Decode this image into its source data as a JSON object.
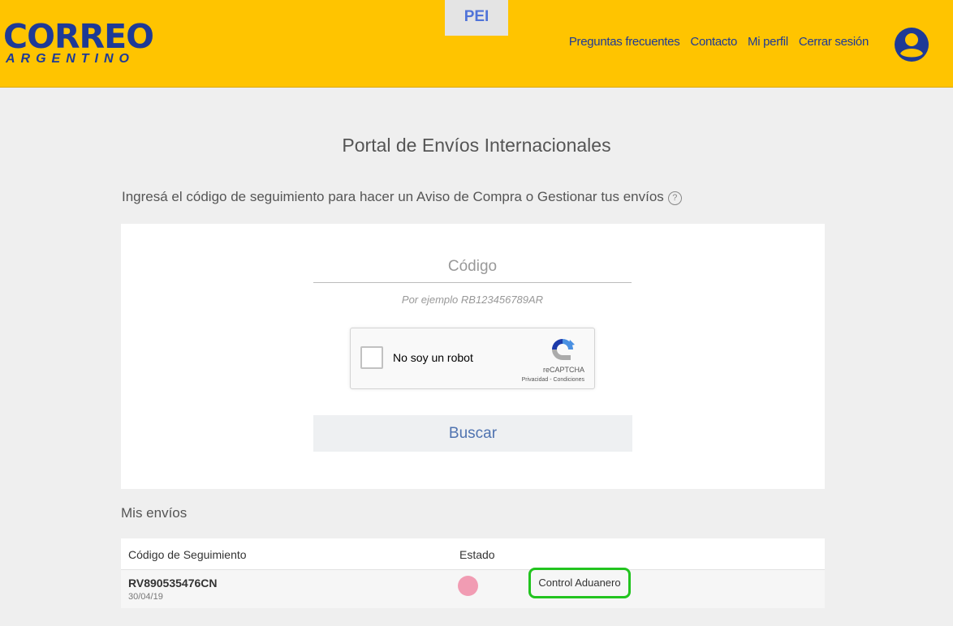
{
  "header": {
    "logo_main": "CORREO",
    "logo_sub": "ARGENTINO",
    "app_tab": "PEI",
    "nav": {
      "faq": "Preguntas frecuentes",
      "contact": "Contacto",
      "profile": "Mi perfil",
      "logout": "Cerrar sesión"
    },
    "avatar_icon": "user-circle-icon"
  },
  "page": {
    "title": "Portal de Envíos Internacionales",
    "instruction": "Ingresá el código de seguimiento para hacer un Aviso de Compra o Gestionar tus envíos",
    "help_icon": "question-circle-icon"
  },
  "search": {
    "code_placeholder": "Código",
    "code_value": "",
    "hint": "Por ejemplo RB123456789AR",
    "button_label": "Buscar"
  },
  "recaptcha": {
    "label": "No soy un robot",
    "brand": "reCAPTCHA",
    "links": "Privacidad - Condiciones"
  },
  "shipments": {
    "title": "Mis envíos",
    "columns": [
      "Código de Seguimiento",
      "Estado"
    ],
    "rows": [
      {
        "code": "RV890535476CN",
        "date": "30/04/19",
        "status": "Control Aduanero",
        "status_color": "#f19cb3"
      }
    ]
  },
  "colors": {
    "header_bg": "#ffc400",
    "brand_blue": "#1e3a96",
    "highlight": "#22c41f"
  }
}
